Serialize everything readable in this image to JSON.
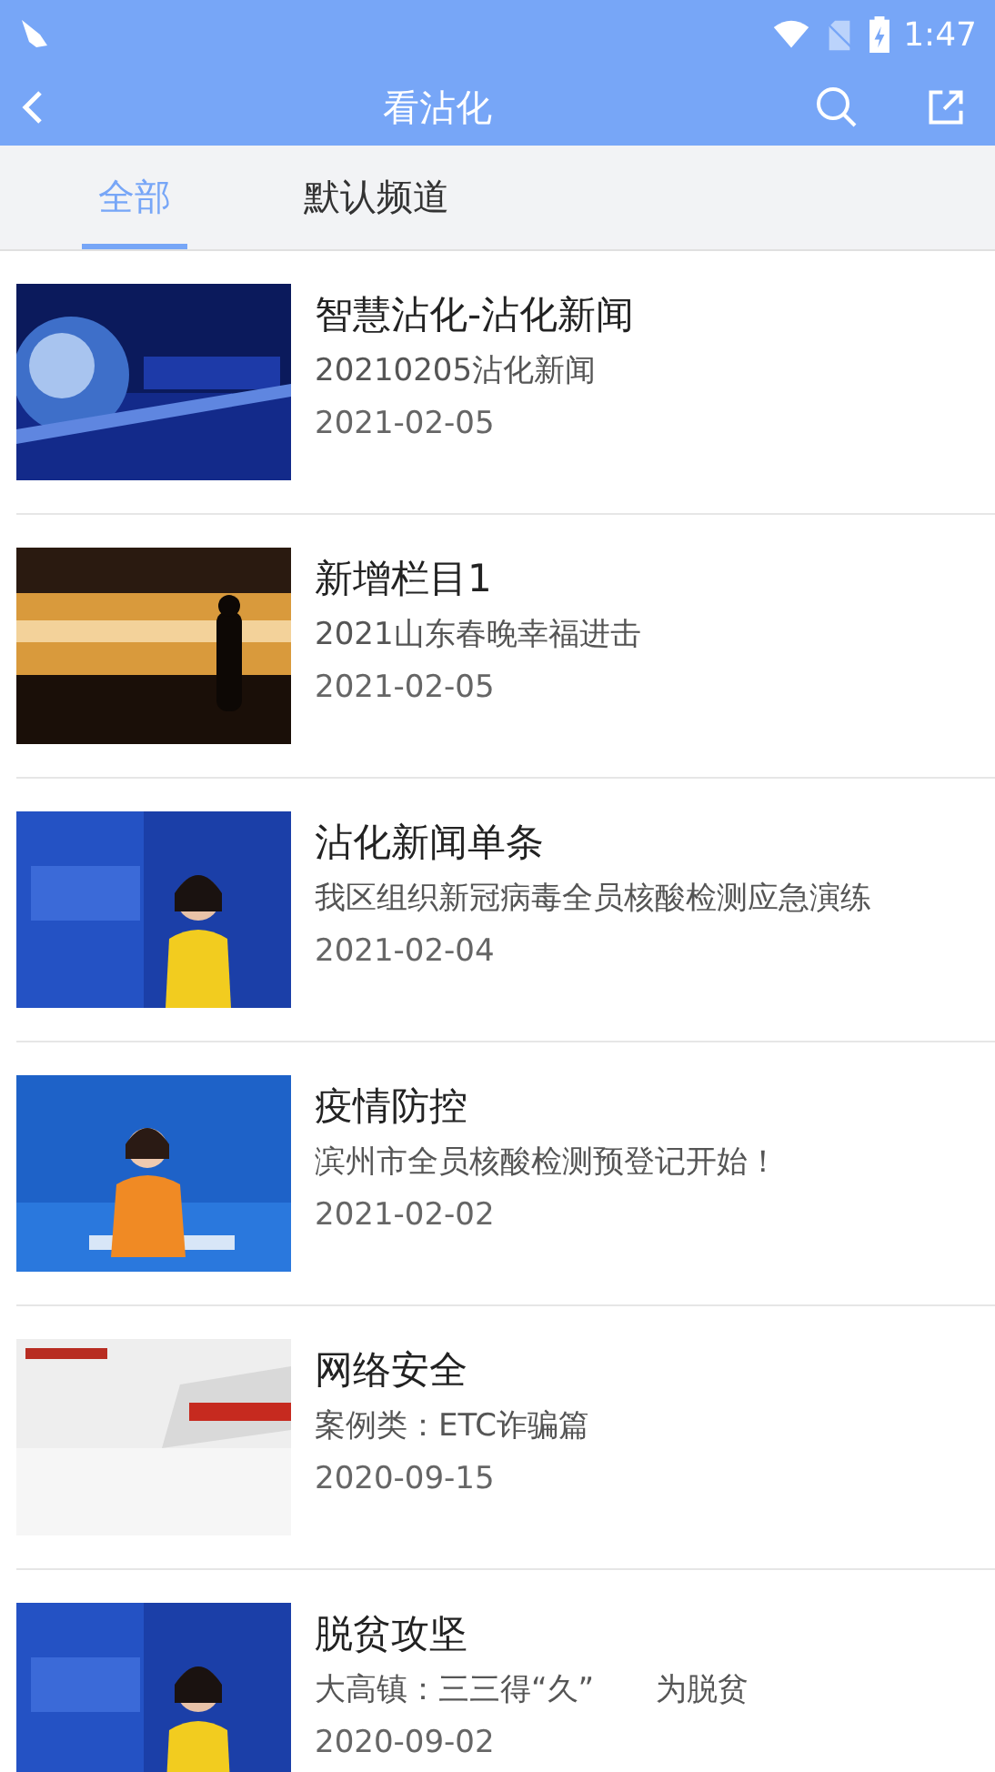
{
  "status_bar": {
    "time": "1:47"
  },
  "header": {
    "title": "看沾化"
  },
  "tabs": [
    {
      "label": "全部",
      "selected": true
    },
    {
      "label": "默认频道",
      "selected": false
    }
  ],
  "items": [
    {
      "title": "智慧沾化-沾化新闻",
      "subtitle": "20210205沾化新闻",
      "date": "2021-02-05"
    },
    {
      "title": "新增栏目1",
      "subtitle": "2021山东春晚幸福进击",
      "date": "2021-02-05"
    },
    {
      "title": "沾化新闻单条",
      "subtitle": "我区组织新冠病毒全员核酸检测应急演练",
      "date": "2021-02-04"
    },
    {
      "title": "疫情防控",
      "subtitle": "滨州市全员核酸检测预登记开始！",
      "date": "2021-02-02"
    },
    {
      "title": "网络安全",
      "subtitle": "案例类：ETC诈骗篇",
      "date": "2020-09-15"
    },
    {
      "title": "脱贫攻坚",
      "subtitle": "大高镇：三三得“久”　　为脱贫",
      "date": "2020-09-02"
    }
  ]
}
